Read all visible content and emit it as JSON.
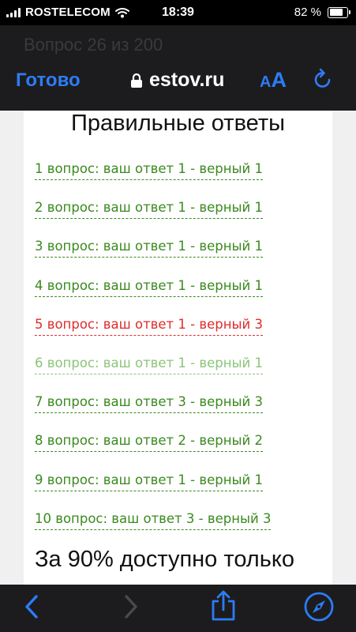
{
  "status_bar": {
    "carrier": "ROSTELECOM",
    "time": "18:39",
    "battery_percent": "82 %",
    "battery_level": 0.82
  },
  "browser": {
    "ghost_title": "Вопрос 26 из 200",
    "done_label": "Готово",
    "url": "estov.ru",
    "text_size_small": "A",
    "text_size_big": "A",
    "accent_color": "#2d7cf6"
  },
  "page": {
    "heading": "Правильные ответы",
    "answers": [
      {
        "text": "1 вопрос: ваш ответ 1 - верный 1",
        "status": "correct",
        "color": "#3a8a1e"
      },
      {
        "text": "2 вопрос: ваш ответ 1 - верный 1",
        "status": "correct",
        "color": "#3a8a1e"
      },
      {
        "text": "3 вопрос: ваш ответ 1 - верный 1",
        "status": "correct",
        "color": "#3a8a1e"
      },
      {
        "text": "4 вопрос: ваш ответ 1 - верный 1",
        "status": "correct",
        "color": "#3a8a1e"
      },
      {
        "text": "5 вопрос: ваш ответ 1 - верный 3",
        "status": "wrong",
        "color": "#e02b2b"
      },
      {
        "text": "6 вопрос: ваш ответ 1 - верный 1",
        "status": "visited",
        "color": "#8cc47a"
      },
      {
        "text": "7 вопрос: ваш ответ 3 - верный 3",
        "status": "correct",
        "color": "#3a8a1e"
      },
      {
        "text": "8 вопрос: ваш ответ 2 - верный 2",
        "status": "correct",
        "color": "#3a8a1e"
      },
      {
        "text": "9 вопрос: ваш ответ 1 - верный 1",
        "status": "correct",
        "color": "#3a8a1e"
      },
      {
        "text": "10 вопрос: ваш ответ 3 - верный 3",
        "status": "correct",
        "color": "#3a8a1e"
      }
    ],
    "summary": "За 90% доступно только"
  },
  "toolbar": {
    "icons": [
      "back-icon",
      "forward-icon",
      "share-icon",
      "compass-icon"
    ]
  }
}
